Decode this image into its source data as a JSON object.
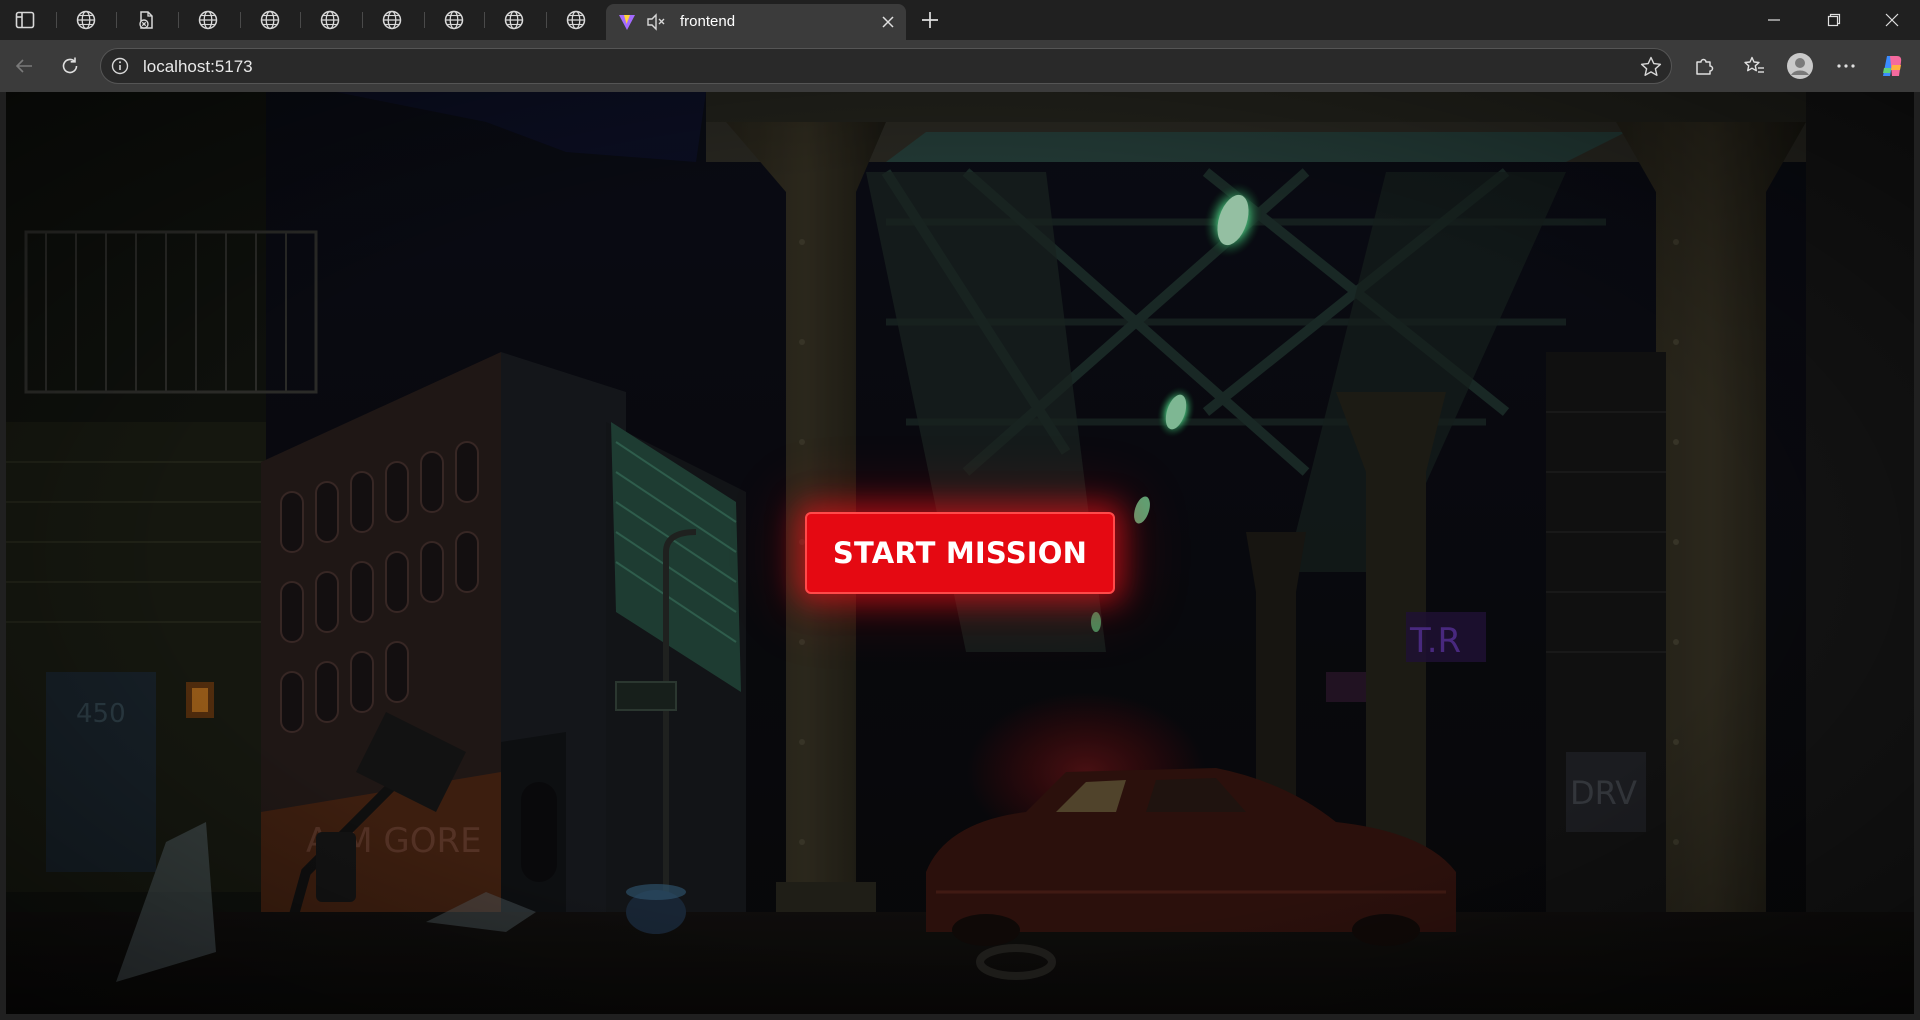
{
  "browser": {
    "active_tab": {
      "title": "frontend"
    },
    "address_bar": {
      "url": "localhost:5173"
    }
  },
  "page": {
    "start_button_label": "START MISSION",
    "accent_color": "#e50912"
  },
  "icons": {
    "tabstrip": [
      "tab-actions-icon",
      "globe-icon",
      "document-error-icon",
      "mute-icon",
      "close-icon",
      "plus-icon"
    ],
    "window": [
      "minimize-icon",
      "restore-icon",
      "close-icon"
    ],
    "toolbar": [
      "back-icon",
      "refresh-icon",
      "info-icon",
      "star-icon",
      "extensions-icon",
      "favorites-icon",
      "profile-icon",
      "more-icon",
      "copilot-icon"
    ]
  }
}
